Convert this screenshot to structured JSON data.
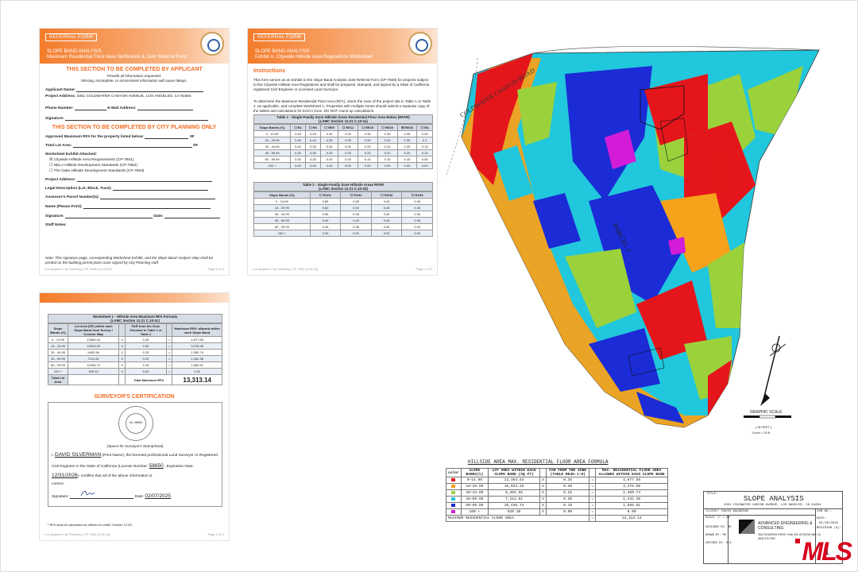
{
  "ref1": {
    "label": "REFERRAL FORM",
    "title1": "SLOPE BAND ANALYSIS",
    "title2": "Maximum Residential Floor Area Verification & Joint Referral Form",
    "applicant_heading": "THIS SECTION TO BE COMPLETED BY APPLICANT",
    "info1": "Provide all information requested.",
    "info2": "Missing, incomplete, or inconsistent information will cause delays.",
    "applicant_name": "Applicant Name:",
    "project_address_label": "Project Address:",
    "project_address": "3351 COLDWATER CANYON AVENUE, LOS ANGELES, CA 91604",
    "phone": "Phone Number:",
    "email": "E-Mail Address:",
    "signature": "Signature:",
    "city_heading": "THIS SECTION TO BE COMPLETED BY CITY PLANNING ONLY",
    "approved": "Approved Maximum RFA for the property listed below:",
    "sf1": "SF",
    "total_lot": "Total Lot Area:",
    "sf2": "SF",
    "worksheet_attached": "Worksheet Exhibit Attached:",
    "cb1": "☒ Citywide Hillside Area Requirements (CP-7851)",
    "cb2": "☐ NELA Hillside Development Standards (CP-7852)",
    "cb3": "☐ The Oaks Hillside Development Standards (CP-7853)",
    "project_address2": "Project Address:",
    "legal": "Legal Description (Lot, Block, Tract):",
    "assessor": "Assessor's Parcel Number(s):",
    "name_print": "Name (Please Print):",
    "signature2": "Signature:",
    "date": "Date:",
    "staff_notes": "Staff Notes:",
    "note": "Note: This signature page, corresponding Worksheet Exhibit, and the Slope Band Analysis Map shall be printed on the building permit plans once signed by City Planning staff.",
    "footer_left": "Los Angeles City Planning | CP-7848 [4.4.2023]",
    "footer_right": "Page 3 of 3"
  },
  "ref2": {
    "label": "REFERRAL FORM",
    "title1": "SLOPE BAND ANALYSIS",
    "title2": "Exhibit A: Citywide Hillside Area Regulations Worksheet",
    "instructions_heading": "Instructions",
    "para1": "This form serves as an Exhibit to the Slope Band Analysis Joint Referral Form (CP-7848) for projects subject to the Citywide Hillside Area Regulations and shall be prepared, stamped, and signed by a State of California registered Civil Engineer or Licensed Land Surveyor.",
    "para2": "To determine the Maximum Residential Floor Area (RFA), check the zone of the project site in Table 1 or Table 2, as applicable, and complete Worksheet 1. Properties with multiple zones should submit a separate copy of the tables and calculations for EACH zone. DO NOT round up calculations.",
    "table1_title": "Table 1 - Single-Family Zone Hillside Areas Residential Floor Area Ratios (RFAR)",
    "table1_sub": "(LAMC Section 12.21 C.10-2a)",
    "table1_headers": [
      "Slope Bands (%)",
      "☐ R1",
      "☐ RS",
      "☐ RE9",
      "☐ RE11",
      "☐ RE15",
      "☐ RE20",
      "☒ RE40",
      "☐ RA"
    ],
    "table1_rows": [
      [
        "0 - 14.99",
        "0.45",
        "0.45",
        "0.40",
        "0.40",
        "0.35",
        "0.35",
        "0.35",
        "0.25"
      ],
      [
        "15 - 29.99",
        "0.45",
        "0.40",
        "0.35",
        "0.35",
        "0.30",
        "0.30",
        "0.30",
        "0.2"
      ],
      [
        "30 - 44.99",
        "0.40",
        "0.35",
        "0.30",
        "0.30",
        "0.25",
        "0.25",
        "0.25",
        "0.15"
      ],
      [
        "45 - 59.99",
        "0.35",
        "0.30",
        "0.25",
        "0.25",
        "0.20",
        "0.20",
        "0.20",
        "0.10"
      ],
      [
        "60 - 99.99",
        "0.30",
        "0.25",
        "0.20",
        "0.20",
        "0.15",
        "0.15",
        "0.15",
        "0.05"
      ],
      [
        "100 +",
        "0.00",
        "0.00",
        "0.00",
        "0.00",
        "0.00",
        "0.00",
        "0.00",
        "0.00"
      ]
    ],
    "table2_title": "Table 2 - Single-Family Zone Hillside Areas RFAR",
    "table2_sub": "(LAMC Section 12.21 C.10-2b)",
    "table2_headers": [
      "Slope Bands (%)",
      "☐ R1H1",
      "☐ R1H2",
      "☐ R1H3",
      "☐ R1H4"
    ],
    "table2_rows": [
      [
        "0 - 14.99",
        "0.65",
        "0.55",
        "0.45",
        "0.40"
      ],
      [
        "15 - 29.99",
        "0.60",
        "0.50",
        "0.45",
        "0.35"
      ],
      [
        "30 - 44.99",
        "0.55",
        "0.45",
        "0.40",
        "0.30"
      ],
      [
        "45 - 59.99",
        "0.50",
        "0.40",
        "0.35",
        "0.25"
      ],
      [
        "60 - 99.99",
        "0.45",
        "0.35",
        "0.30",
        "0.20"
      ],
      [
        "100 +",
        "0.00",
        "0.00",
        "0.00",
        "0.00"
      ]
    ],
    "footer_left": "Los Angeles City Planning | CP-7851 [3.28.23]",
    "footer_right": "Page 1 of 2"
  },
  "ws": {
    "title": "Worksheet 1 - Hillside Area Maximum RFA Formula",
    "sub": "(LAMC Section 12.21 C.10-2c)",
    "headers": [
      "Slope Bands (%)",
      "Lot Area (SF) within each Slope Band from Survey / Contour Map",
      "",
      "FAR from the Zone Checked in Table 1 or Table 2",
      "",
      "Maximum RFA¹ allowed within each Slope Band"
    ],
    "rows": [
      [
        "0 - 14.99",
        "13364.44",
        "X",
        "0.35",
        "=",
        "4,677.55"
      ],
      [
        "15 - 29.99",
        "10923.25",
        "X",
        "0.30",
        "=",
        "3,276.98"
      ],
      [
        "30 - 44.99",
        "9402.96",
        "X",
        "0.25",
        "=",
        "2,350.74"
      ],
      [
        "45 - 59.99",
        "7211.81",
        "X",
        "0.20",
        "=",
        "1,442.36"
      ],
      [
        "60 - 99.99",
        "10436.74",
        "X",
        "0.15",
        "=",
        "1,565.51"
      ],
      [
        "100 +",
        "920.10",
        "X",
        "0.00",
        "=",
        "0.00"
      ]
    ],
    "total_lot_label": "Total Lot Area",
    "total_max_label": "Total Maximum RFA",
    "total_max": "13,313.14",
    "surveyor_heading": "SURVEYOR'S CERTIFICATION",
    "stamp_caption": "(Space for Surveyor's Stamp/Seal)",
    "stamp_no": "No. 58650",
    "name": "DAVID SILVERMAN",
    "print_name_text": "(Print Name), the licensed professional Land Surveyor or Registered",
    "civil_text": "Civil Engineer in the State of California (License Number:",
    "license": "58650",
    "exp_label": "Expiration Date:",
    "exp_date": "12/31/2026",
    "certifies": "), certifies that all of the above information is",
    "correct": "correct.",
    "signature_label": "Signature:",
    "date_label": "Date:",
    "date": "02/07/2025",
    "footnote": "¹ RFA shall be calculated as defined in LAMC Section 12.03.",
    "footer_left": "Los Angeles City Planning | CP-7851 [3.28.23]",
    "footer_right": "Page 2 of 2"
  },
  "map": {
    "road": "COLDWATER CANYON ROAD",
    "parcel": "PARCEL 1",
    "scale_title": "GRAPHIC SCALE",
    "scale_unit": "( IN FEET )",
    "scale_ratio": "1 inch = 20 ft."
  },
  "hc": {
    "title": "HILLSIDE AREA MAX. RESIDENTIAL FLOOR AREA FORMULA",
    "headers": [
      "color",
      "SLOPE BANDS(%)",
      "LOT AREA WITHIN EACH SLOPE BAND (SQ FT)",
      "",
      "FAR FROM THE ZONE (TABLE RE40-1-H)",
      "",
      "MAX. RESIDENTIAL FLOOR AREA ALLOWED WITHIN EACH SLOPE BAND"
    ],
    "rows": [
      {
        "color": "#e4161b",
        "band": "0—14.99",
        "area": "13,364.44",
        "x": "X",
        "far": "0.35",
        "eq": "=",
        "max": "4,677.55"
      },
      {
        "color": "#f6a21a",
        "band": "15—29.99",
        "area": "10,923.25",
        "x": "X",
        "far": "0.30",
        "eq": "=",
        "max": "3,276.98"
      },
      {
        "color": "#9bd23c",
        "band": "30—44.99",
        "area": "9,402.96",
        "x": "X",
        "far": "0.25",
        "eq": "=",
        "max": "2,350.74"
      },
      {
        "color": "#21c7dc",
        "band": "45—59.99",
        "area": "7,211.81",
        "x": "X",
        "far": "0.20",
        "eq": "=",
        "max": "1,442.36"
      },
      {
        "color": "#1b2bd6",
        "band": "60—99.99",
        "area": "10,436.74",
        "x": "X",
        "far": "0.15",
        "eq": "=",
        "max": "1,565.51"
      },
      {
        "color": "#d21cd7",
        "band": "100 +",
        "area": "920.10",
        "x": "X",
        "far": "0.00",
        "eq": "=",
        "max": "0.00"
      }
    ],
    "total_label": "MAXIMUM RESIDENTIAL FLOOR AREA",
    "total_eq": "=",
    "total": "13,313.14"
  },
  "titleblock": {
    "title_label": "TITLE:",
    "title": "SLOPE ANALYSIS",
    "address": "3351 COLDWATER CANYON AVENUE, LOS ANGELES, CA 91604",
    "client_label": "CLIENT:",
    "client": "DAVID KAZAKIAN",
    "job_label": "JOB NO.:",
    "date_label": "DATE:",
    "date": "01/20/2025",
    "revision_label": "REVISION (S):",
    "scale_label": "SCALE:",
    "scale": "1\" = 20'",
    "designed_label": "DESIGNED BY:",
    "designed": "MD",
    "drawn_label": "DRAWN BY:",
    "drawn": "MD",
    "checked_label": "CHECKED BY:",
    "checked": "D.S.",
    "company": "ADVANCED ENGINEERING & CONSULTING",
    "company_addr": "2610 ROADSIDE DRIVE, Suite 300, AGOURA Hills, CA",
    "company_phone": "(818) 222-7960",
    "sheet": "1"
  },
  "watermark": "MLS"
}
